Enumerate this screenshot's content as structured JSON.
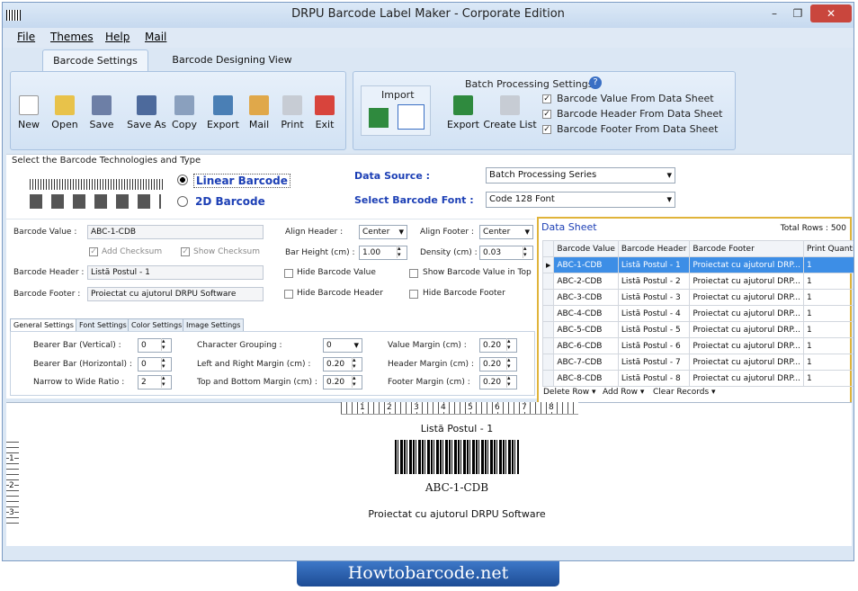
{
  "app": {
    "title": "DRPU Barcode Label Maker - Corporate Edition",
    "footer_brand": "Howtobarcode.net"
  },
  "menu": [
    "File",
    "Themes",
    "Help",
    "Mail"
  ],
  "tabs": [
    "Barcode Settings",
    "Barcode Designing View"
  ],
  "toolbar": {
    "new": "New",
    "open": "Open",
    "save": "Save",
    "save_as": "Save As",
    "copy": "Copy",
    "export": "Export",
    "mail": "Mail",
    "print": "Print",
    "exit": "Exit"
  },
  "batch": {
    "title": "Batch Processing Settings",
    "import": "Import",
    "export": "Export",
    "create_list": "Create List",
    "opts": [
      "Barcode Value From Data Sheet",
      "Barcode Header From Data Sheet",
      "Barcode Footer From Data Sheet"
    ]
  },
  "tech": {
    "heading": "Select the Barcode Technologies and Type",
    "linear": "Linear Barcode",
    "twod": "2D Barcode"
  },
  "source": {
    "label": "Data Source :",
    "value": "Batch Processing Series",
    "font_label": "Select Barcode Font :",
    "font": "Code 128 Font"
  },
  "fields": {
    "value_label": "Barcode Value :",
    "value": "ABC-1-CDB",
    "add_checksum": "Add Checksum",
    "show_checksum": "Show Checksum",
    "header_label": "Barcode Header :",
    "header": "Listă Postul - 1",
    "footer_label": "Barcode Footer :",
    "footer": "Proiectat cu ajutorul DRPU Software",
    "align_header": "Align Header :",
    "align_header_v": "Center",
    "align_footer": "Align Footer :",
    "align_footer_v": "Center",
    "bar_height": "Bar Height (cm) :",
    "bar_height_v": "1.00",
    "density": "Density (cm) :",
    "density_v": "0.03",
    "hide_value": "Hide Barcode Value",
    "show_value_top": "Show Barcode Value in Top",
    "hide_header": "Hide Barcode Header",
    "hide_footer": "Hide Barcode Footer"
  },
  "subtabs": [
    "General Settings",
    "Font Settings",
    "Color Settings",
    "Image Settings"
  ],
  "general": {
    "bb_v": "Bearer Bar (Vertical) :",
    "bb_v_val": "0",
    "bb_h": "Bearer Bar (Horizontal) :",
    "bb_h_val": "0",
    "ntw": "Narrow to Wide Ratio :",
    "ntw_val": "2",
    "cg": "Character Grouping :",
    "cg_val": "0",
    "lr": "Left and Right Margin (cm) :",
    "lr_val": "0.20",
    "tb": "Top and Bottom Margin (cm) :",
    "tb_val": "0.20",
    "vm": "Value Margin (cm) :",
    "vm_val": "0.20",
    "hm": "Header Margin (cm) :",
    "hm_val": "0.20",
    "fm": "Footer Margin (cm) :",
    "fm_val": "0.20"
  },
  "sheet": {
    "title": "Data Sheet",
    "total": "Total Rows : 500",
    "cols": [
      "Barcode Value",
      "Barcode Header",
      "Barcode Footer",
      "Print Quantity"
    ],
    "rows": [
      [
        "ABC-1-CDB",
        "Listă Postul - 1",
        "Proiectat cu ajutorul DRP...",
        "1"
      ],
      [
        "ABC-2-CDB",
        "Listă Postul - 2",
        "Proiectat cu ajutorul DRP...",
        "1"
      ],
      [
        "ABC-3-CDB",
        "Listă Postul - 3",
        "Proiectat cu ajutorul DRP...",
        "1"
      ],
      [
        "ABC-4-CDB",
        "Listă Postul - 4",
        "Proiectat cu ajutorul DRP...",
        "1"
      ],
      [
        "ABC-5-CDB",
        "Listă Postul - 5",
        "Proiectat cu ajutorul DRP...",
        "1"
      ],
      [
        "ABC-6-CDB",
        "Listă Postul - 6",
        "Proiectat cu ajutorul DRP...",
        "1"
      ],
      [
        "ABC-7-CDB",
        "Listă Postul - 7",
        "Proiectat cu ajutorul DRP...",
        "1"
      ],
      [
        "ABC-8-CDB",
        "Listă Postul - 8",
        "Proiectat cu ajutorul DRP...",
        "1"
      ]
    ],
    "actions": [
      "Delete Row",
      "Add Row",
      "Clear Records"
    ]
  },
  "ruler": [
    "1",
    "2",
    "3",
    "4",
    "5",
    "6",
    "7",
    "8"
  ],
  "vruler": [
    "1",
    "2",
    "3"
  ],
  "preview": {
    "header": "Listă Postul - 1",
    "value": "ABC-1-CDB",
    "footer": "Proiectat cu ajutorul DRPU Software"
  }
}
